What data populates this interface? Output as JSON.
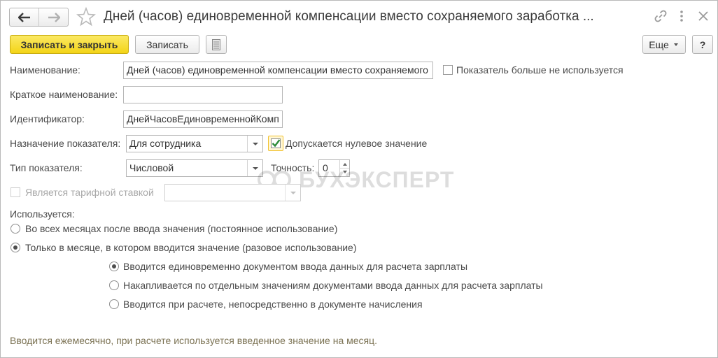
{
  "window": {
    "title": "Дней (часов) единовременной компенсации вместо сохраняемого заработка ..."
  },
  "toolbar": {
    "save_close_label": "Записать и закрыть",
    "save_label": "Записать",
    "more_label": "Еще",
    "help_label": "?"
  },
  "form": {
    "name": {
      "label": "Наименование:",
      "value": "Дней (часов) единовременной компенсации вместо сохраняемого",
      "unused_checkbox_label": "Показатель больше не используется",
      "unused_checked": false
    },
    "short_name": {
      "label": "Краткое наименование:",
      "value": ""
    },
    "identifier": {
      "label": "Идентификатор:",
      "value": "ДнейЧасовЕдиновременнойКомп"
    },
    "purpose": {
      "label": "Назначение показателя:",
      "value": "Для сотрудника",
      "zero_allowed_label": "Допускается нулевое значение",
      "zero_allowed_checked": true
    },
    "type": {
      "label": "Тип показателя:",
      "value": "Числовой",
      "precision_label": "Точность:",
      "precision_value": "0"
    },
    "tariff": {
      "label": "Является тарифной ставкой",
      "checked": false,
      "disabled": true,
      "value": ""
    },
    "usage": {
      "label": "Используется:",
      "options": [
        {
          "label": "Во всех месяцах после ввода значения (постоянное использование)",
          "selected": false
        },
        {
          "label": "Только в месяце, в котором вводится значение (разовое использование)",
          "selected": true
        }
      ],
      "sub_options": [
        {
          "label": "Вводится единовременно документом ввода данных для расчета зарплаты",
          "selected": true
        },
        {
          "label": "Накапливается по отдельным значениям документами ввода данных для расчета зарплаты",
          "selected": false
        },
        {
          "label": "Вводится при расчете, непосредственно в документе начисления",
          "selected": false
        }
      ]
    },
    "footer_note": "Вводится ежемесячно, при расчете используется введенное значение на месяц."
  },
  "watermark": {
    "text": "БУХЭКСПЕРТ"
  },
  "colors": {
    "primary_button": "#f3d417",
    "checkbox_check": "#2e8b3a",
    "footer_text": "#7b7253"
  }
}
